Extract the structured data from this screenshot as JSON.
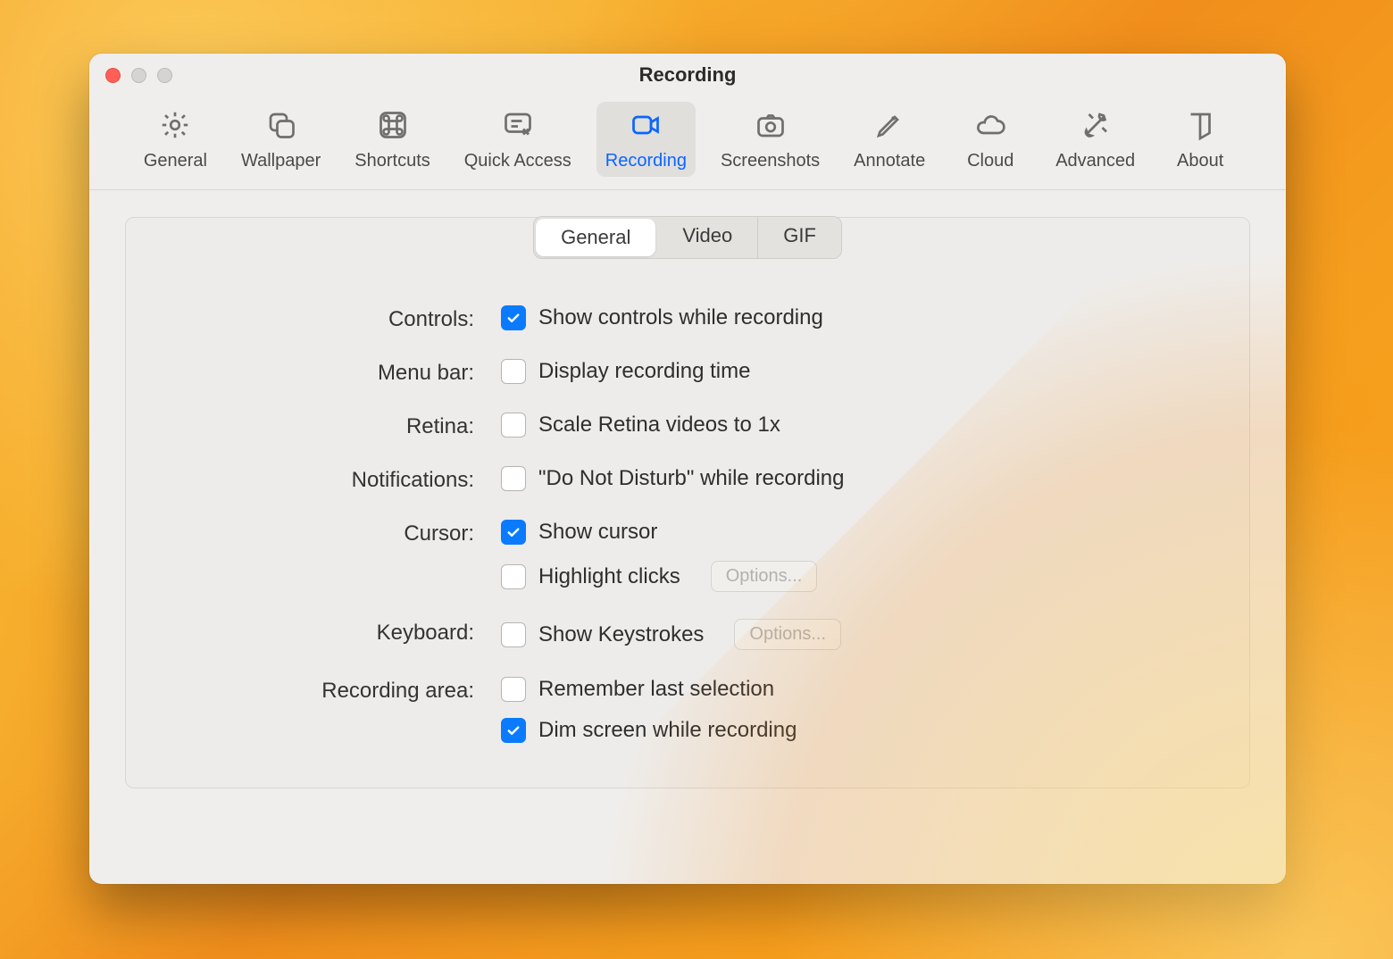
{
  "window": {
    "title": "Recording"
  },
  "toolbar": {
    "items": [
      {
        "label": "General"
      },
      {
        "label": "Wallpaper"
      },
      {
        "label": "Shortcuts"
      },
      {
        "label": "Quick Access"
      },
      {
        "label": "Recording"
      },
      {
        "label": "Screenshots"
      },
      {
        "label": "Annotate"
      },
      {
        "label": "Cloud"
      },
      {
        "label": "Advanced"
      },
      {
        "label": "About"
      }
    ],
    "active_index": 4
  },
  "segmented": {
    "options": [
      "General",
      "Video",
      "GIF"
    ],
    "active_index": 0
  },
  "settings": {
    "controls": {
      "label": "Controls:",
      "show_controls": {
        "text": "Show controls while recording",
        "checked": true
      }
    },
    "menubar": {
      "label": "Menu bar:",
      "display_time": {
        "text": "Display recording time",
        "checked": false
      }
    },
    "retina": {
      "label": "Retina:",
      "scale": {
        "text": "Scale Retina videos to 1x",
        "checked": false
      }
    },
    "notifications": {
      "label": "Notifications:",
      "dnd": {
        "text": "\"Do Not Disturb\" while recording",
        "checked": false
      }
    },
    "cursor": {
      "label": "Cursor:",
      "show": {
        "text": "Show cursor",
        "checked": true
      },
      "highlight": {
        "text": "Highlight clicks",
        "checked": false,
        "options_label": "Options..."
      }
    },
    "keyboard": {
      "label": "Keyboard:",
      "keystrokes": {
        "text": "Show Keystrokes",
        "checked": false,
        "options_label": "Options..."
      }
    },
    "area": {
      "label": "Recording area:",
      "remember": {
        "text": "Remember last selection",
        "checked": false
      },
      "dim": {
        "text": "Dim screen while recording",
        "checked": true
      }
    }
  }
}
